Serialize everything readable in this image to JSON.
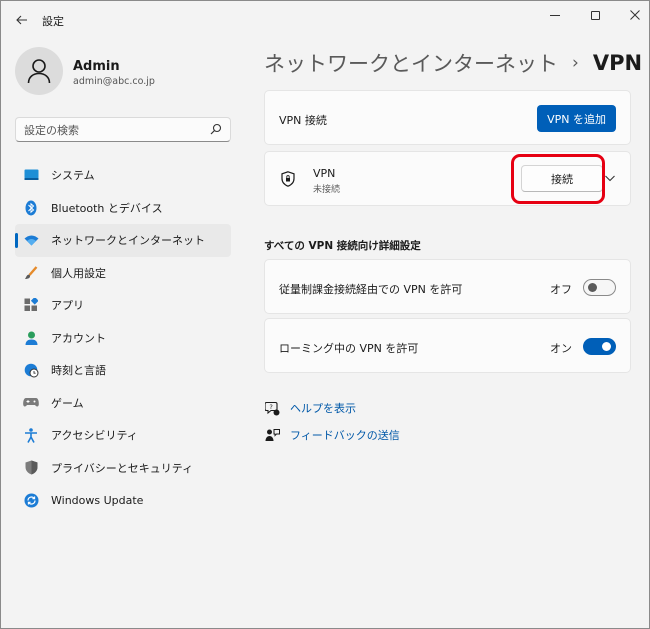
{
  "window": {
    "app_title": "設定"
  },
  "user": {
    "name": "Admin",
    "email": "admin@abc.co.jp"
  },
  "search": {
    "placeholder": "設定の検索"
  },
  "sidebar": {
    "items": [
      {
        "label": "システム",
        "icon": "display-icon"
      },
      {
        "label": "Bluetooth とデバイス",
        "icon": "bluetooth-icon"
      },
      {
        "label": "ネットワークとインターネット",
        "icon": "wifi-icon",
        "active": true
      },
      {
        "label": "個人用設定",
        "icon": "brush-icon"
      },
      {
        "label": "アプリ",
        "icon": "apps-icon"
      },
      {
        "label": "アカウント",
        "icon": "person-icon"
      },
      {
        "label": "時刻と言語",
        "icon": "globe-clock-icon"
      },
      {
        "label": "ゲーム",
        "icon": "gamepad-icon"
      },
      {
        "label": "アクセシビリティ",
        "icon": "accessibility-icon"
      },
      {
        "label": "プライバシーとセキュリティ",
        "icon": "shield-icon"
      },
      {
        "label": "Windows Update",
        "icon": "update-icon"
      }
    ]
  },
  "breadcrumb": {
    "parent": "ネットワークとインターネット",
    "separator": "›",
    "current": "VPN"
  },
  "vpn_connections": {
    "label": "VPN 接続",
    "add_button": "VPN を追加"
  },
  "vpn_entry": {
    "name": "VPN",
    "status": "未接続",
    "connect_button": "接続"
  },
  "advanced": {
    "title": "すべての VPN 接続向け詳細設定",
    "metered": {
      "label": "従量制課金接続経由での VPN を許可",
      "state": "オフ",
      "on": false
    },
    "roaming": {
      "label": "ローミング中の VPN を許可",
      "state": "オン",
      "on": true
    }
  },
  "links": {
    "help": "ヘルプを表示",
    "feedback": "フィードバックの送信"
  },
  "colors": {
    "accent": "#005fb8",
    "highlight": "#e60012"
  }
}
